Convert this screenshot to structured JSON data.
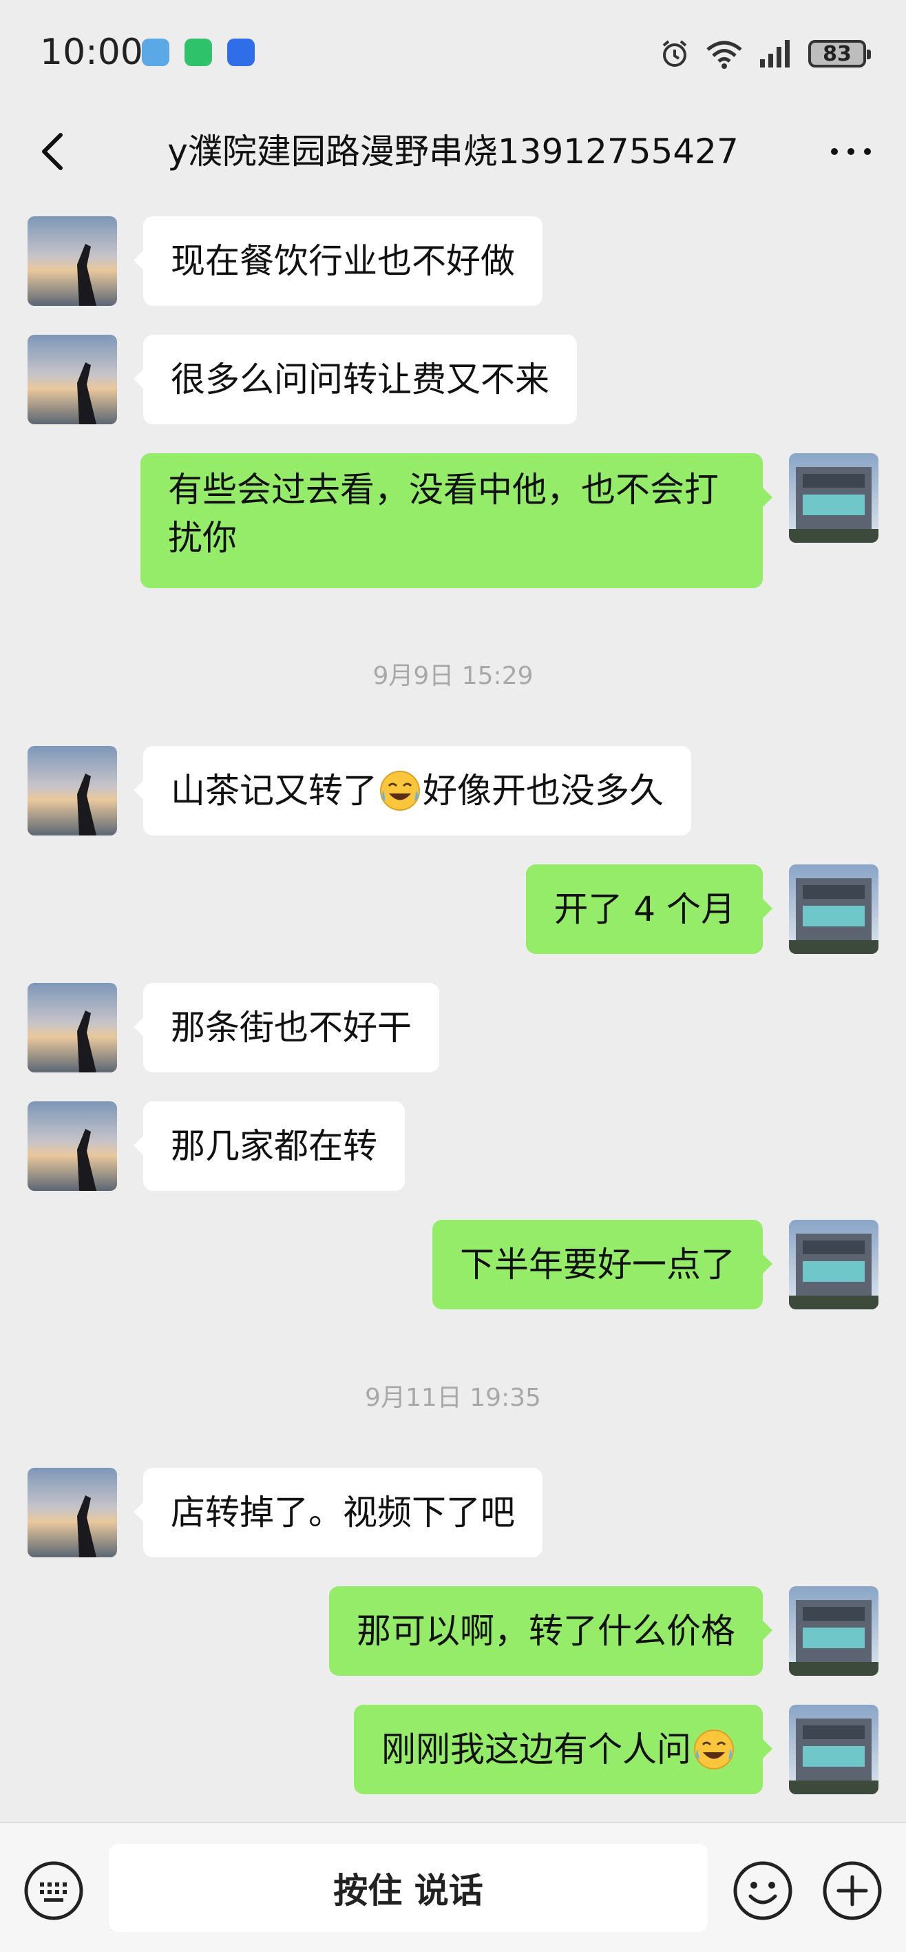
{
  "status_bar": {
    "time": "10:00",
    "battery": "83"
  },
  "header": {
    "title": "y濮院建园路漫野串烧13912755427"
  },
  "messages": {
    "m1": "现在餐饮行业也不好做",
    "m2": "很多么问问转让费又不来",
    "m3": "有些会过去看，没看中他，也不会打扰你",
    "ts1": "9月9日 15:29",
    "m4a": "山茶记又转了",
    "m4b": "好像开也没多久",
    "m5": "开了 4 个月",
    "m6": "那条街也不好干",
    "m7": "那几家都在转",
    "m8": "下半年要好一点了",
    "ts2": "9月11日 19:35",
    "m9": "店转掉了。视频下了吧",
    "m10": "那可以啊，转了什么价格",
    "m11": "刚刚我这边有个人问"
  },
  "input_bar": {
    "voice_label": "按住 说话"
  },
  "icons": {
    "status_left": [
      "drop-icon",
      "wechat-icon",
      "voice-app-icon"
    ],
    "status_right": [
      "alarm-icon",
      "wifi-icon",
      "signal-icon",
      "battery-icon"
    ],
    "emoji": "face-with-tears-of-joy"
  },
  "colors": {
    "outgoing_bubble": "#95ec69",
    "incoming_bubble": "#ffffff",
    "background": "#ededed"
  }
}
